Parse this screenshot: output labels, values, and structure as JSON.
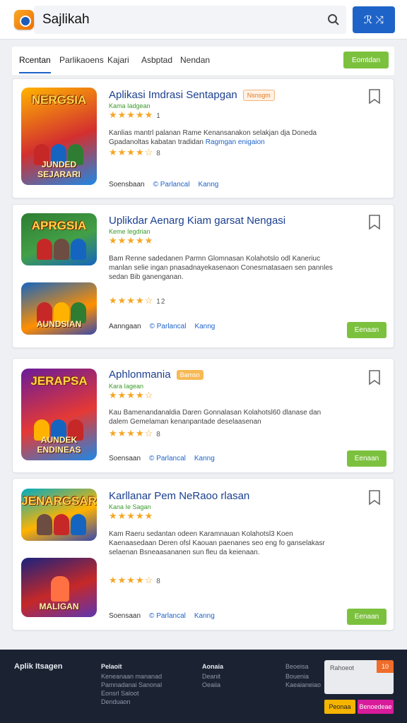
{
  "header": {
    "app_title": "Sajlikah",
    "search_placeholder": "",
    "user_button_label": "ℛ ⤨"
  },
  "tabs": [
    {
      "label": "Rcentan",
      "active": true
    },
    {
      "label": "Parlikaoens",
      "active": false
    },
    {
      "label": "Kajari",
      "active": false
    },
    {
      "label": "Asbptad",
      "active": false
    },
    {
      "label": "Nendan",
      "active": false
    }
  ],
  "filter_button": "Eomtdan",
  "cards": [
    {
      "title": "Aplikasi Imdrasi Sentapgan",
      "badge": "Nsnsgm",
      "developer": "Kama Iadgean",
      "rating": 4.5,
      "rating_count": "1",
      "rating2": 4.5,
      "rating2_count": "8",
      "desc": "Kanlias mantrl palanan Rame Kenansanakon selakjan dja Doneda Gpadanoltas kabatan tradidan",
      "desc_link": "Ragmgan enigaion",
      "meta_left": "Soensbaan",
      "meta_link1": "© Parlancal",
      "meta_link2": "Kanng",
      "install": ""
    },
    {
      "title": "Uplikdar Aenarg Kiam garsat Nengasi",
      "badge": "",
      "developer": "Keme Iegdrian",
      "rating": 4.5,
      "rating_count": "",
      "rating2": 4.5,
      "rating2_count": "12",
      "desc": "Bam Renne sadedanen Parmn Glomnasan Kolahotslo odl Kaneriuc manlan selie ingan pnasadnayekasenaon Conesrnatasaen sen pannles sedan Bib ganenganan.",
      "desc_link": "",
      "meta_left": "Aanngaan",
      "meta_link1": "© Parlancal",
      "meta_link2": "Kanng",
      "install": "Eenaan"
    },
    {
      "title": "Aphlonmania",
      "badge": "Bamsn",
      "developer": "Kara Iagean",
      "rating": 4,
      "rating_count": "",
      "rating2": 4.5,
      "rating2_count": "8",
      "desc": "Kau Bamenandanaldia Daren Gonnalasan Kolahotsl60 dlanase dan dalem Gemelaman kenanpantade deselaasenan",
      "desc_link": "",
      "meta_left": "Soensaan",
      "meta_link1": "© Parlancal",
      "meta_link2": "Kanng",
      "install": "Eenaan"
    },
    {
      "title": "Karllanar Pem NeRaoo rlasan",
      "badge": "",
      "developer": "Kana Ie Sagan",
      "rating": 4.5,
      "rating_count": "",
      "rating2": 4.5,
      "rating2_count": "8",
      "desc": "Kam Raeru sedantan odeen Karamnauan Kolahotsl3 Koen Kaenaasedaan Deren ofsl Kaouan paenanes seo eng fo ganselakasr selaenan Bsneaasananen sun fleu da keienaan.",
      "desc_link": "",
      "meta_left": "Soensaan",
      "meta_link1": "© Parlancal",
      "meta_link2": "Kanng",
      "install": "Eenaan"
    }
  ],
  "thumbnails": [
    {
      "top": "NERGSIA",
      "bottom": "JUNDED SEJARARI",
      "palette": [
        "#ffb300",
        "#d32f2f",
        "#1e88e5"
      ]
    },
    {
      "top": "APRGSIA",
      "bottom": "",
      "palette": [
        "#2e7d32",
        "#43a047",
        "#1565c0"
      ]
    },
    {
      "top": "",
      "bottom": "AUNDSIAN",
      "palette": [
        "#1565c0",
        "#ff8f00",
        "#3949ab"
      ]
    },
    {
      "top": "JERAPSA",
      "bottom": "AUNDEK ENDINEAS",
      "palette": [
        "#6a1b9a",
        "#e53935",
        "#1e88e5"
      ]
    },
    {
      "top": "JENARGSAR",
      "bottom": "",
      "palette": [
        "#00acc1",
        "#ffb300",
        "#3949ab"
      ]
    },
    {
      "top": "",
      "bottom": "MALIGAN",
      "palette": [
        "#1a237e",
        "#c62828",
        "#5e35b1"
      ]
    }
  ],
  "footer": {
    "brand": "Aplik Itsagen",
    "col1_title": "Pelaoit",
    "col1_items": [
      "Keneanaan mananad",
      "Pamnadanai Sanonal",
      "Eonsrl Saloot",
      "Denduaon"
    ],
    "col2_title": "Aonaia",
    "col2_items": [
      "Deanit",
      "Oeaiia"
    ],
    "col3_title": "Beoeisa",
    "col3_items": [
      "Bouenia",
      "Kaeaianeiao"
    ],
    "input_text": "Rahoeot",
    "input_btn": "10",
    "btn1": "Peonaa",
    "btn2": "Benoedeae"
  },
  "colors": {
    "accent": "#1e63c8",
    "install_green": "#7cc13e",
    "star": "#f5a623",
    "footer_bg": "#1b2333"
  }
}
